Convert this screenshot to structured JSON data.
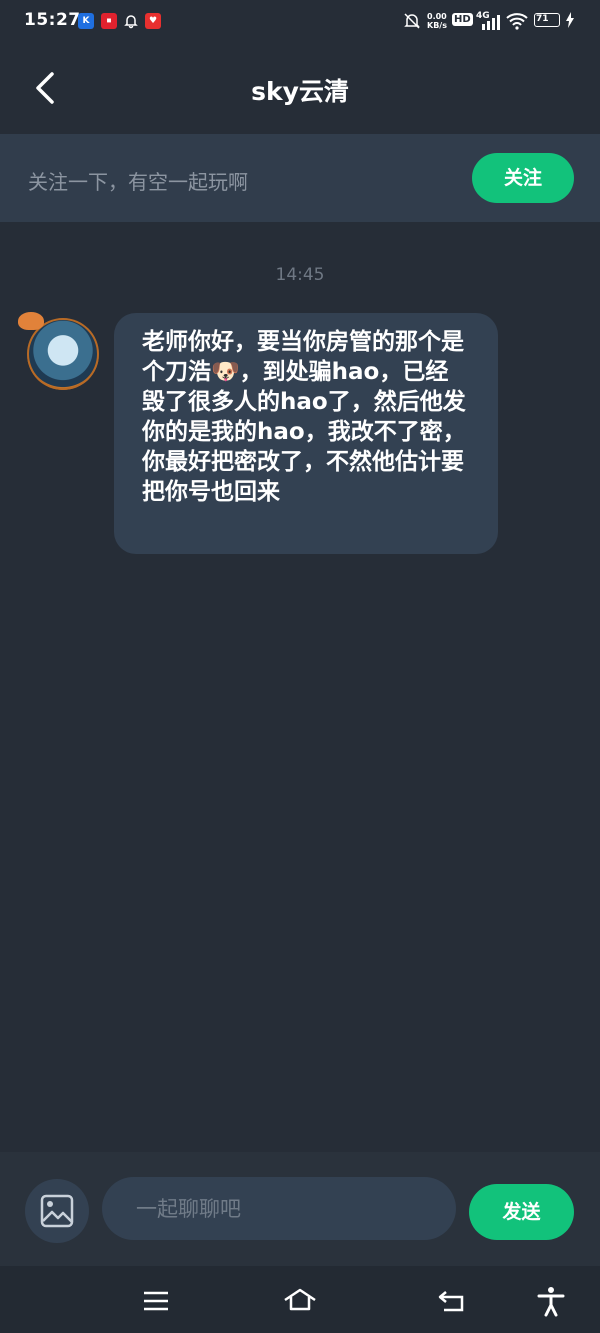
{
  "status_bar": {
    "time": "15:27",
    "network_speed": "0.00 KB/s",
    "hd_label": "HD",
    "network_type": "4G",
    "battery": "71"
  },
  "header": {
    "title": "sky云清",
    "back_icon": "chevron-left-icon"
  },
  "follow_bar": {
    "text": "关注一下，有空一起玩啊",
    "button_label": "关注"
  },
  "conversation": {
    "timestamp": "14:45",
    "messages": [
      {
        "sender": "other",
        "text": "老师你好，要当你房管的那个是个刀浩🐶，到处骗hao，已经毁了很多人的hao了，然后他发你的是我的hao，我改不了密，你最好把密改了，不然他估计要把你号也回来"
      }
    ]
  },
  "composer": {
    "image_icon": "image-icon",
    "placeholder": "一起聊聊吧",
    "send_label": "发送"
  },
  "nav_bar": {
    "icons": [
      "menu-icon",
      "home-icon",
      "back-icon",
      "accessibility-icon"
    ]
  },
  "colors": {
    "background": "#262d37",
    "accent": "#12c27b",
    "bubble": "#334152",
    "follow_bar": "#313d4c"
  }
}
